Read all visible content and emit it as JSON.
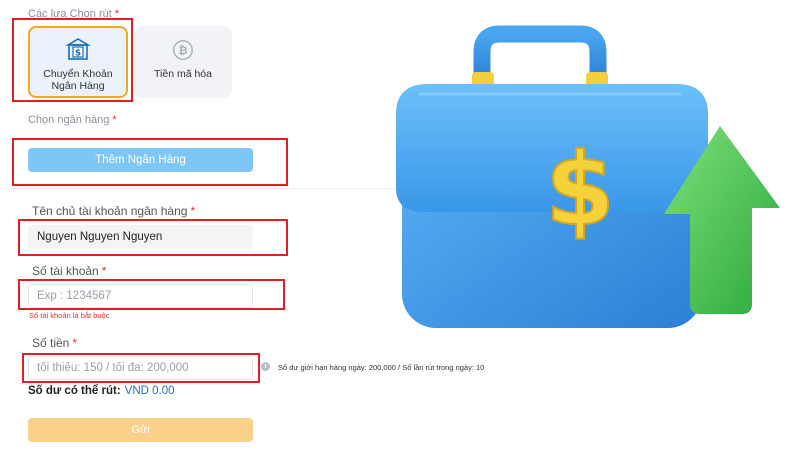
{
  "withdraw_options": {
    "label": "Các lựa Chọn rút",
    "required_mark": "*",
    "methods": [
      {
        "label": "Chuyển Khoản Ngân Hàng",
        "icon": "bank-transfer-icon",
        "selected": true
      },
      {
        "label": "Tiền mã hóa",
        "icon": "bitcoin-icon",
        "selected": false
      }
    ]
  },
  "bank": {
    "label": "Chọn ngân hàng",
    "required_mark": "*",
    "add_button": "Thêm Ngân Hàng"
  },
  "account_holder": {
    "label": "Tên chủ tài khoản ngân hàng",
    "required_mark": "*",
    "value": "Nguyen Nguyen Nguyen"
  },
  "account_number": {
    "label": "Số tài khoản",
    "required_mark": "*",
    "placeholder": "Exp : 1234567",
    "error": "Số tài khoản là bắt buộc"
  },
  "amount": {
    "label": "Số tiền",
    "required_mark": "*",
    "placeholder": "tối thiểu: 150 / tối đa: 200,000",
    "limit_info": "Số dư giới hạn hàng ngày: 200,000 / Số lần rút trong ngày: 10"
  },
  "balance": {
    "label": "Số dư có thể rút:",
    "value": "VND 0.00"
  },
  "submit_button": "Gửi",
  "colors": {
    "accent_orange": "#f5a623",
    "button_blue": "#7ec6f7",
    "submit_orange": "#fbd08b",
    "error_red": "#e03131",
    "highlight_red": "#e02020",
    "briefcase_blue": "#3a97e8",
    "dollar_yellow": "#f5d23a",
    "arrow_green": "#3bc14a"
  },
  "illustration": "briefcase-dollar-arrow-illustration"
}
